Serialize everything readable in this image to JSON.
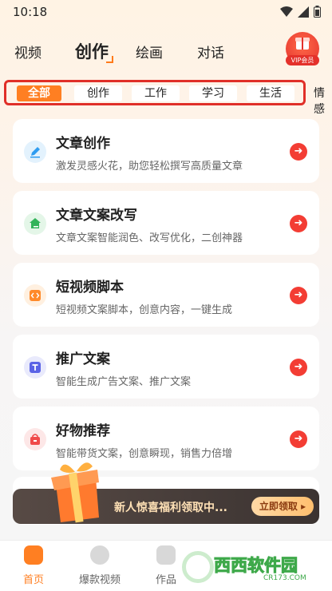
{
  "status_bar": {
    "time": "10:18",
    "icons": [
      "wifi-icon",
      "signal-icon",
      "battery-icon"
    ]
  },
  "top_nav": {
    "tabs": [
      {
        "label": "视频",
        "active": false
      },
      {
        "label": "创作",
        "active": true
      },
      {
        "label": "绘画",
        "active": false
      },
      {
        "label": "对话",
        "active": false
      }
    ],
    "vip_label": "VIP会员"
  },
  "categories": {
    "items": [
      {
        "label": "全部",
        "active": true
      },
      {
        "label": "创作",
        "active": false
      },
      {
        "label": "工作",
        "active": false
      },
      {
        "label": "学习",
        "active": false
      },
      {
        "label": "生活",
        "active": false
      }
    ],
    "overflow_label": "情感"
  },
  "cards": [
    {
      "title": "文章创作",
      "desc": "激发灵感火花，助您轻松撰写高质量文章",
      "icon": "pen-icon",
      "icon_color": "#2f9cf0",
      "icon_bg": "#e3f2fd"
    },
    {
      "title": "文章文案改写",
      "desc": "文章文案智能润色、改写优化，二创神器",
      "icon": "house-edit-icon",
      "icon_color": "#33b35a",
      "icon_bg": "#e4f6e8"
    },
    {
      "title": "短视频脚本",
      "desc": "短视频文案脚本，创意内容，一键生成",
      "icon": "code-icon",
      "icon_color": "#ff8a2a",
      "icon_bg": "#fff0e0"
    },
    {
      "title": "推广文案",
      "desc": "智能生成广告文案、推广文案",
      "icon": "text-t-icon",
      "icon_color": "#5a63e6",
      "icon_bg": "#e9eafc"
    },
    {
      "title": "好物推荐",
      "desc": "智能带货文案，创意瞬现，销售力倍增",
      "icon": "shopping-bag-icon",
      "icon_color": "#f04a4a",
      "icon_bg": "#fde7e7"
    }
  ],
  "promo": {
    "text": "新人惊喜福利领取中...",
    "button": "立即领取 ▸"
  },
  "bottom_nav": [
    {
      "label": "首页",
      "active": true
    },
    {
      "label": "爆款视频",
      "active": false
    },
    {
      "label": "作品",
      "active": false
    }
  ],
  "watermark": {
    "brand_green": "西西",
    "brand_white": "软件园",
    "domain": "CR173.COM"
  },
  "colors": {
    "accent": "#ff7f22",
    "arrow": "#f33d34",
    "highlight_border": "#e02f28"
  }
}
